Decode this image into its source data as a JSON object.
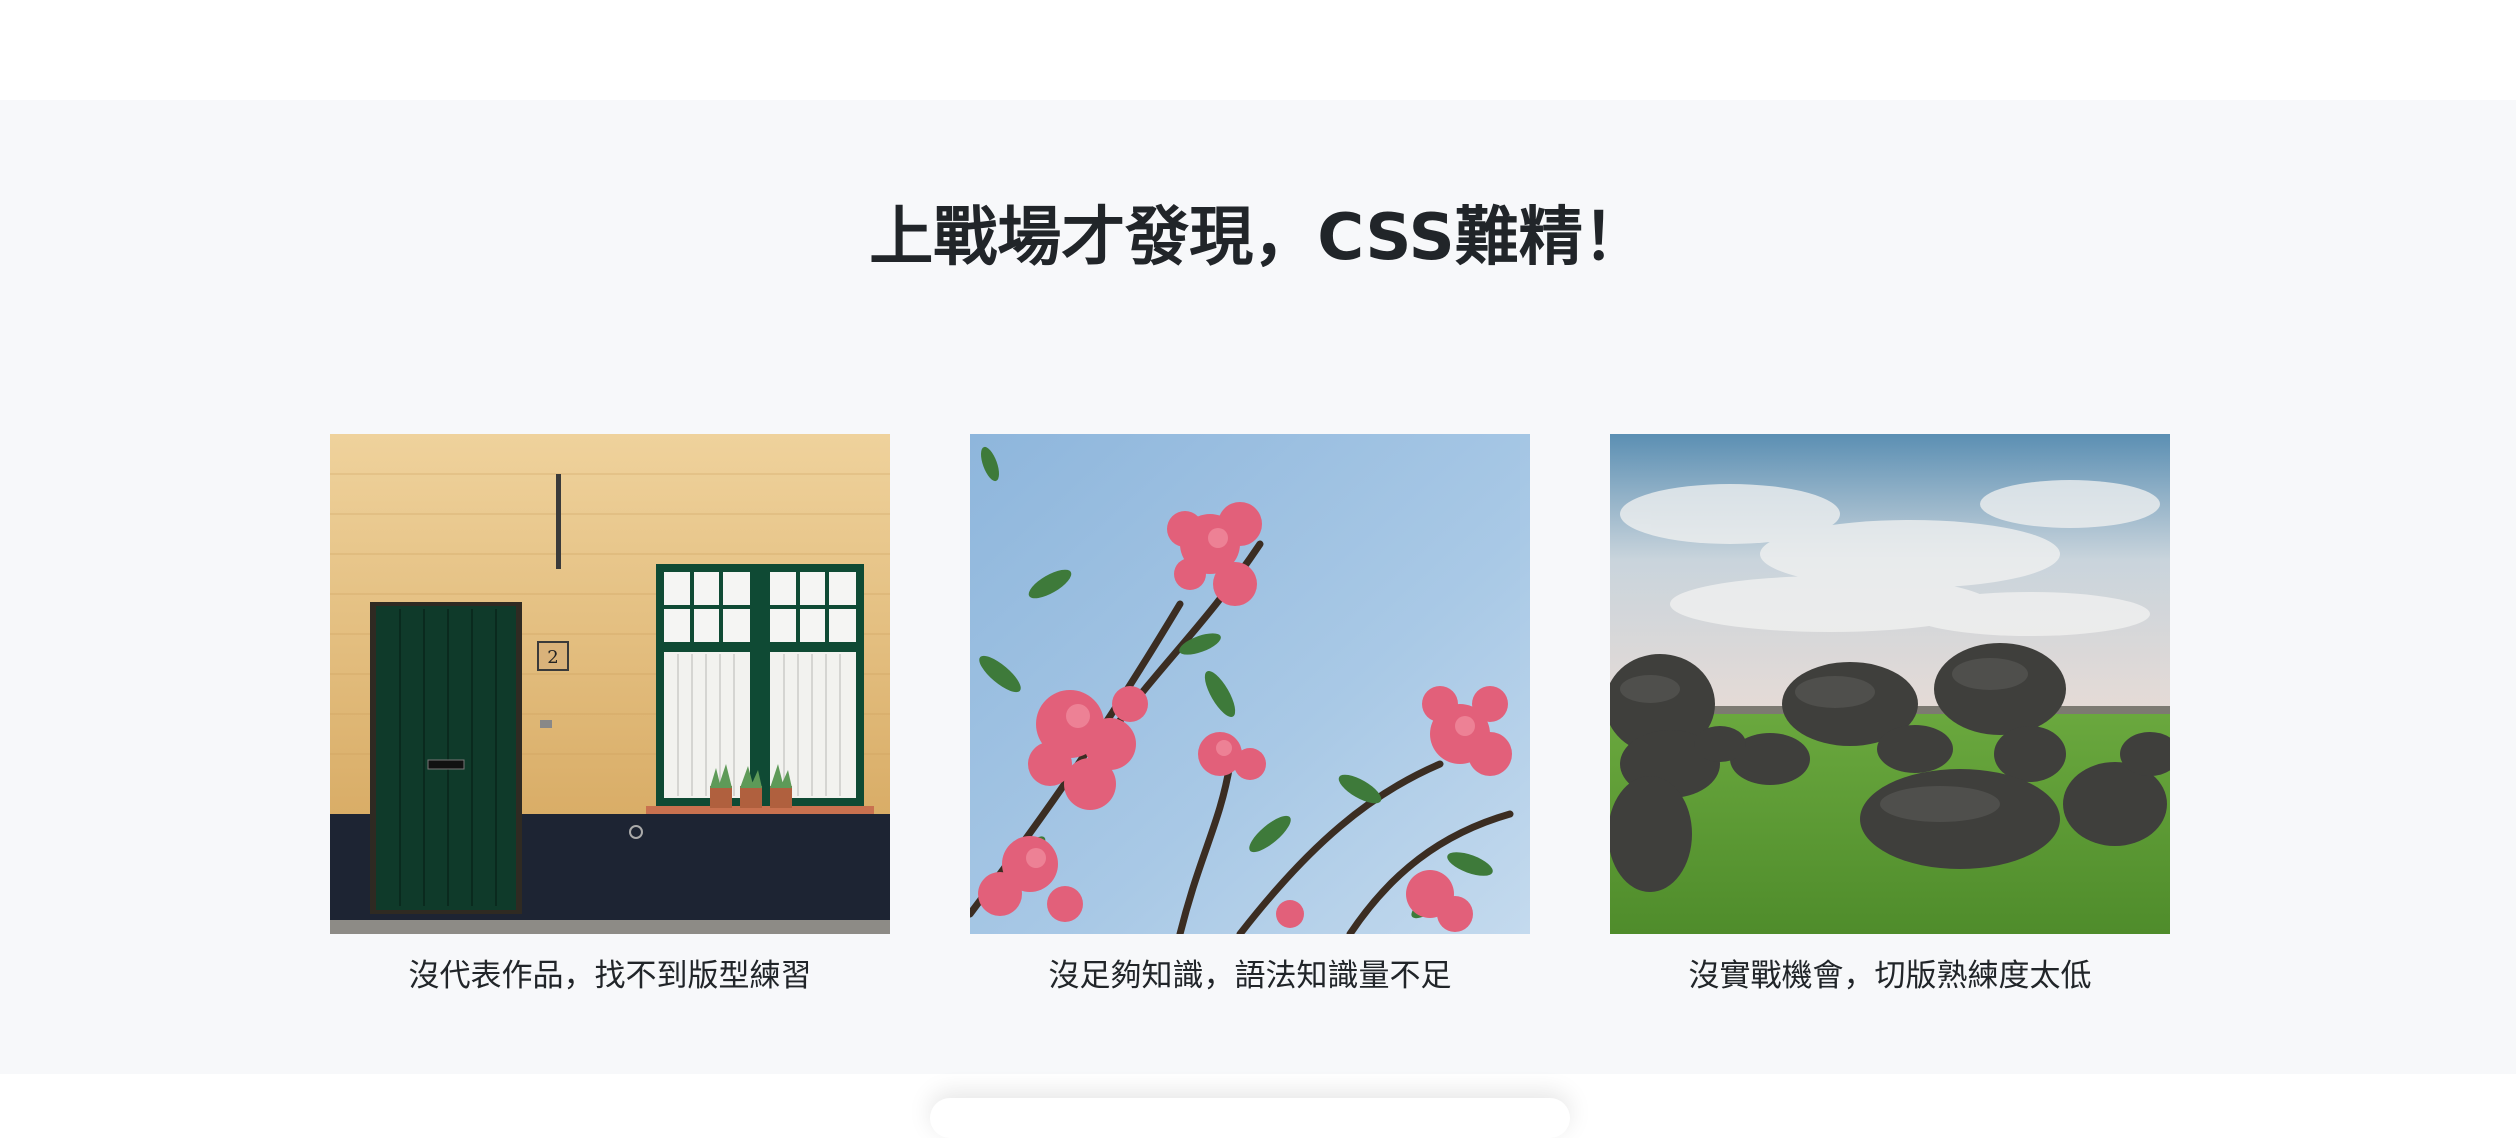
{
  "section": {
    "title": "上戰場才發現，CSS難精！"
  },
  "cards": [
    {
      "image": "yellow-brick-wall-with-green-door-and-window-photo",
      "caption": "沒代表作品，找不到版型練習"
    },
    {
      "image": "pink-flowers-against-blue-sky-photo",
      "caption": "沒足夠知識，語法知識量不足"
    },
    {
      "image": "boulders-on-green-grass-under-cloudy-sky-photo",
      "caption": "沒實戰機會，切版熟練度太低"
    }
  ],
  "photo_elements": {
    "house_number": "2"
  }
}
